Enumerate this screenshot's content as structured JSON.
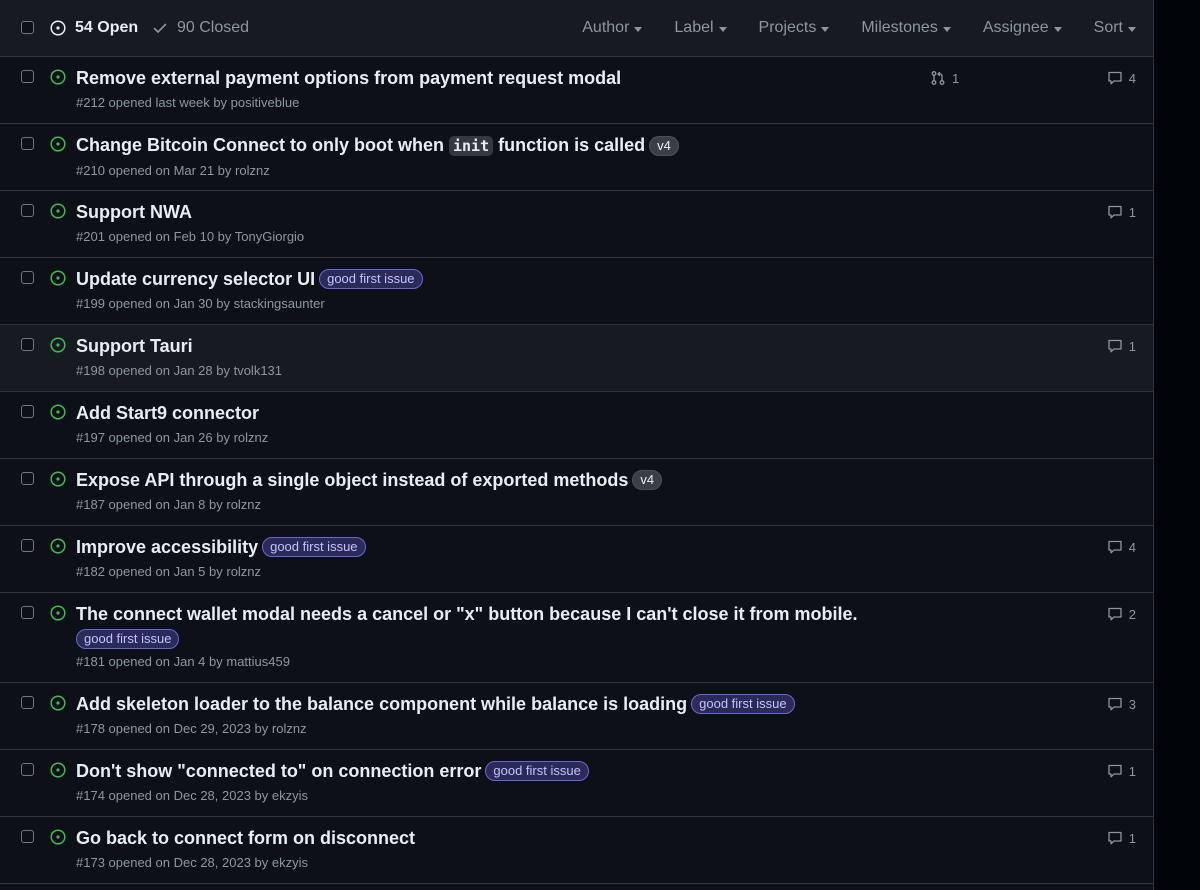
{
  "header": {
    "open_label": "54 Open",
    "closed_label": "90 Closed",
    "filters": [
      "Author",
      "Label",
      "Projects",
      "Milestones",
      "Assignee",
      "Sort"
    ]
  },
  "colors": {
    "open_icon": "#3fb950",
    "label_good_first_issue_bg": "#2b2b5a",
    "label_good_first_issue_text": "#c4c2ff",
    "label_v4_bg": "#3a3f46"
  },
  "issues": [
    {
      "title": "Remove external payment options from payment request modal",
      "meta_prefix": "#212 opened last week by ",
      "author": "positiveblue",
      "linked_prs": "1",
      "comments": "4"
    },
    {
      "title_before": "Change Bitcoin Connect to only boot when ",
      "title_code": "init",
      "title_after": " function is called",
      "label": "v4",
      "meta_prefix": "#210 opened on Mar 21 by ",
      "author": "rolznz"
    },
    {
      "title": "Support NWA",
      "meta_prefix": "#201 opened on Feb 10 by ",
      "author": "TonyGiorgio",
      "comments": "1"
    },
    {
      "title": "Update currency selector UI",
      "label": "good first issue",
      "meta_prefix": "#199 opened on Jan 30 by ",
      "author": "stackingsaunter"
    },
    {
      "title": "Support Tauri",
      "meta_prefix": "#198 opened on Jan 28 by ",
      "author": "tvolk131",
      "comments": "1"
    },
    {
      "title": "Add Start9 connector",
      "meta_prefix": "#197 opened on Jan 26 by ",
      "author": "rolznz"
    },
    {
      "title": "Expose API through a single object instead of exported methods",
      "label": "v4",
      "meta_prefix": "#187 opened on Jan 8 by ",
      "author": "rolznz"
    },
    {
      "title": "Improve accessibility",
      "label": "good first issue",
      "meta_prefix": "#182 opened on Jan 5 by ",
      "author": "rolznz",
      "comments": "4"
    },
    {
      "title": "The connect wallet modal needs a cancel or \"x\" button because I can't close it from mobile.",
      "label": "good first issue",
      "meta_prefix": "#181 opened on Jan 4 by ",
      "author": "mattius459",
      "comments": "2"
    },
    {
      "title": "Add skeleton loader to the balance component while balance is loading",
      "label": "good first issue",
      "meta_prefix": "#178 opened on Dec 29, 2023 by ",
      "author": "rolznz",
      "comments": "3"
    },
    {
      "title": "Don't show \"connected to\" on connection error",
      "label": "good first issue",
      "meta_prefix": "#174 opened on Dec 28, 2023 by ",
      "author": "ekzyis",
      "comments": "1"
    },
    {
      "title": "Go back to connect form on disconnect",
      "meta_prefix": "#173 opened on Dec 28, 2023 by ",
      "author": "ekzyis",
      "comments": "1"
    }
  ]
}
